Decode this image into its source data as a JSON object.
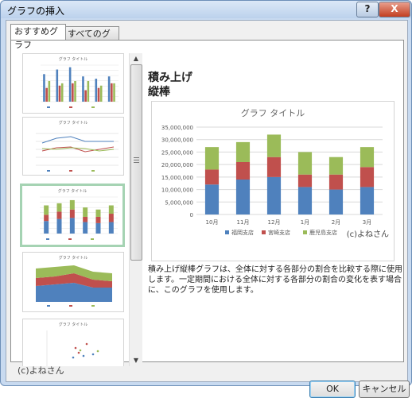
{
  "window": {
    "title": "グラフの挿入",
    "help_label": "?",
    "close_label": "X"
  },
  "tabs": [
    {
      "label": "おすすめグラフ",
      "active": true
    },
    {
      "label": "すべてのグラフ",
      "active": false
    }
  ],
  "thumbnails": [
    {
      "title": "グラフ タイトル",
      "type": "clustered-column",
      "selected": false
    },
    {
      "title": "グラフ タイトル",
      "type": "line",
      "selected": false
    },
    {
      "title": "グラフ タイトル",
      "type": "stacked-column",
      "selected": true
    },
    {
      "title": "グラフ タイトル",
      "type": "stacked-area",
      "selected": false
    },
    {
      "title": "グラフ タイトル",
      "type": "scatter",
      "selected": false
    }
  ],
  "detail": {
    "heading_line1": "積み上げ",
    "heading_line2": "縦棒",
    "description": "積み上げ縦棒グラフは、全体に対する各部分の割合を比較する際に使用します。一定期間における全体に対する各部分の割合の変化を表す場合に、このグラフを使用します。"
  },
  "chart_watermark": "(c)よねさん",
  "footer": {
    "credit": "(c)よねさん",
    "ok_label": "OK",
    "cancel_label": "キャンセル"
  },
  "colors": {
    "blue": "#4f81bd",
    "red": "#c0504d",
    "green": "#9bbb59",
    "selected_border": "#a5d3b3"
  },
  "chart_data": {
    "type": "bar",
    "stacked": true,
    "title": "グラフ タイトル",
    "categories": [
      "10月",
      "11月",
      "12月",
      "1月",
      "2月",
      "3月"
    ],
    "series": [
      {
        "name": "福岡支店",
        "values": [
          12000000,
          14000000,
          15000000,
          11000000,
          10000000,
          11000000
        ]
      },
      {
        "name": "宮崎支店",
        "values": [
          6000000,
          7000000,
          8000000,
          5000000,
          6000000,
          8000000
        ]
      },
      {
        "name": "鹿児島支店",
        "values": [
          9000000,
          8000000,
          9000000,
          9000000,
          7000000,
          8000000
        ]
      }
    ],
    "yticks": [
      "0",
      "5,000,000",
      "10,000,000",
      "15,000,000",
      "20,000,000",
      "25,000,000",
      "30,000,000",
      "35,000,000"
    ],
    "ylim": [
      0,
      35000000
    ],
    "grid": true,
    "legend_position": "bottom"
  }
}
